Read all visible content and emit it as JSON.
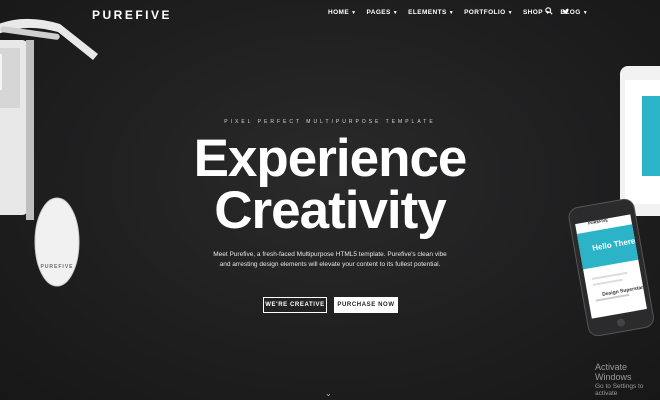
{
  "brand": {
    "logo": "PUREFIVE"
  },
  "nav": {
    "items": [
      {
        "label": "HOME"
      },
      {
        "label": "PAGES"
      },
      {
        "label": "ELEMENTS"
      },
      {
        "label": "PORTFOLIO"
      },
      {
        "label": "SHOP"
      },
      {
        "label": "BLOG"
      }
    ],
    "icons": [
      "search-icon",
      "twitter-icon"
    ]
  },
  "hero": {
    "tagline": "PIXEL PERFECT MULTIPURPOSE TEMPLATE",
    "title_line1": "Experience",
    "title_line2": "Creativity",
    "description": "Meet Purefive, a fresh-faced Multipurpose HTML5 template. Purefive's clean vibe and arresting design elements will elevate your content to its fullest potential.",
    "primary_button": "WE'RE CREATIVE",
    "secondary_button": "PURCHASE NOW"
  },
  "devices": {
    "mouse_label": "PUREFIVE",
    "phone_brand": "PUREFIVE",
    "phone_hero": "Hello There",
    "phone_subtitle": "Design Superstars"
  },
  "system": {
    "activate_title": "Activate Windows",
    "activate_sub": "Go to Settings to activate"
  },
  "colors": {
    "accent": "#2bb3c8",
    "background": "#1f1f20",
    "text": "#ffffff"
  }
}
